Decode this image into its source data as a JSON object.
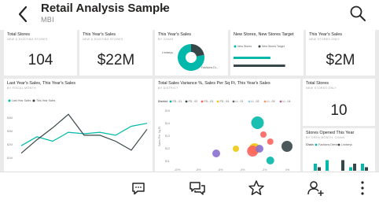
{
  "header": {
    "title": "Retail Analysis Sample",
    "subtitle": "MBI"
  },
  "icons": {
    "back": "back-arrow-icon",
    "dropdown": "chevron-down-icon",
    "search": "search-icon",
    "comment": "comment-icon",
    "conversation": "conversation-icon",
    "favorite": "star-icon",
    "invite": "add-person-icon",
    "more": "more-vertical-icon"
  },
  "colors": {
    "teal": "#01b8aa",
    "navy": "#374649",
    "red": "#fd625e",
    "yellow": "#f2c80f",
    "purple": "#8a6fcf"
  },
  "tiles": {
    "total_stores": {
      "title": "Total Stores",
      "sub": "NEW & EXISTING STORES",
      "value": "104"
    },
    "this_year_sales": {
      "title": "This Year's Sales",
      "sub": "NEW & EXISTING STORES",
      "value": "$22M"
    },
    "ty_sales_pie": {
      "title": "This Year's Sales",
      "sub": "BY CHAIN",
      "legend": [
        "Lindseys",
        "Fashions Di..."
      ]
    },
    "new_stores_target": {
      "title": "New Stores, New Stores Target",
      "sub": "",
      "legend": [
        "New Stores",
        "New Stores Target"
      ]
    },
    "ty_sales_new": {
      "title": "This Year's Sales",
      "sub": "NEW STORES ONLY",
      "value": "$2M"
    },
    "last_year_sales": {
      "title": "Last Year's Sales, This Year's Sales",
      "sub": "BY FISCAL MONTH",
      "legend": [
        "Last Year Sales",
        "This Year Sales"
      ],
      "yticks": [
        "$4M",
        "$3M",
        "$2M",
        "$1M"
      ]
    },
    "variance": {
      "title": "Total Sales Variance %, Sales Per Sq Ft, This Year's Sales",
      "sub": "BY DISTRICT",
      "legend_label": "District",
      "legend": [
        "FD - 01",
        "FD - 02",
        "FD - 03",
        "FD - 04",
        "LI - 01",
        "LI - 02",
        "LI - 03",
        "LI - 04"
      ],
      "ylabel": "Sales Per Sq Ft",
      "yticks": [
        "$15",
        "$14",
        "$13",
        "$12",
        "$11"
      ],
      "xticks": [
        "-10%",
        "-8%",
        "-6%",
        "-4%",
        "-2%",
        "0%"
      ]
    },
    "total_stores_new": {
      "title": "Total Stores",
      "sub": "NEW STORES ONLY",
      "value": "10"
    },
    "stores_opened": {
      "title": "Stores Opened This Year",
      "sub": "BY OPEN MONTH, CHAIN",
      "legend_label": "Chain",
      "legend": [
        "Fashions Direct",
        "Lindseys"
      ]
    }
  },
  "chart_data": [
    {
      "type": "pie",
      "title": "This Year's Sales",
      "categories": [
        "Lindseys",
        "Fashions Di..."
      ],
      "values": [
        22,
        78
      ],
      "colors": [
        "#374649",
        "#01b8aa"
      ]
    },
    {
      "type": "line",
      "title": "Last Year's Sales, This Year's Sales",
      "ylim": [
        0.5,
        4.5
      ],
      "series": [
        {
          "name": "Last Year Sales",
          "color": "#01b8aa",
          "values": [
            1.7,
            2.3,
            2.0,
            2.6,
            2.5,
            2.6,
            2.4,
            3.0,
            3.2
          ]
        },
        {
          "name": "This Year Sales",
          "color": "#374649",
          "values": [
            1.2,
            2.1,
            2.9,
            3.8,
            2.4,
            2.4,
            2.0,
            1.4,
            2.8
          ]
        }
      ]
    },
    {
      "type": "scatter",
      "title": "Total Sales Variance %, Sales Per Sq Ft, This Year's Sales",
      "xlim": [
        -11,
        1
      ],
      "ylim": [
        10.6,
        15.4
      ],
      "points": [
        {
          "x": -2.8,
          "y": 14.2,
          "size": 8,
          "color": "#01b8aa"
        },
        {
          "x": -1.5,
          "y": 12.6,
          "size": 4,
          "color": "#fd625e"
        },
        {
          "x": -2.2,
          "y": 13.2,
          "size": 4,
          "color": "#fd625e"
        },
        {
          "x": -3.1,
          "y": 12.0,
          "size": 7,
          "color": "#f2c80f"
        },
        {
          "x": -3.3,
          "y": 11.8,
          "size": 7,
          "color": "#fd625e"
        },
        {
          "x": -2.6,
          "y": 12.0,
          "size": 5,
          "color": "#8a6fcf"
        },
        {
          "x": -7.0,
          "y": 11.6,
          "size": 5,
          "color": "#8a6fcf"
        },
        {
          "x": -5.0,
          "y": 12.0,
          "size": 4,
          "color": "#f2c80f"
        },
        {
          "x": -1.5,
          "y": 11.0,
          "size": 5,
          "color": "#01b8aa"
        },
        {
          "x": 0.2,
          "y": 12.2,
          "size": 7,
          "color": "#374649"
        }
      ]
    },
    {
      "type": "bar",
      "title": "Stores Opened This Year",
      "series": [
        {
          "name": "Fashions Direct",
          "color": "#01b8aa",
          "values": [
            2,
            3,
            0,
            1,
            2
          ]
        },
        {
          "name": "Lindseys",
          "color": "#374649",
          "values": [
            1,
            0,
            3,
            2,
            1
          ]
        }
      ]
    },
    {
      "type": "bar",
      "title": "New Stores, New Stores Target",
      "series": [
        {
          "name": "New Stores",
          "color": "#01b8aa",
          "values": [
            10
          ]
        },
        {
          "name": "New Stores Target",
          "color": "#374649",
          "values": [
            14
          ]
        }
      ]
    }
  ]
}
